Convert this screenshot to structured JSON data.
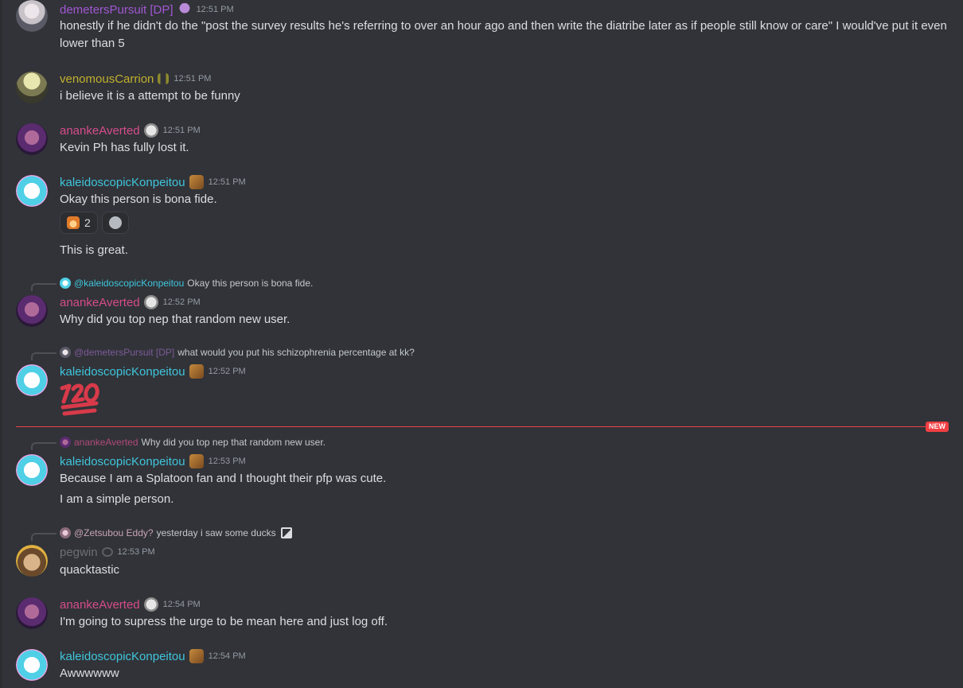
{
  "messages": [
    {
      "user": "demetersPursuit [DP]",
      "color": "#a257d3",
      "time": "12:51 PM",
      "badge": "octopus-badge",
      "text": "honestly if he didn't do the \"post the survey results he's referring to over an hour ago and then write the diatribe later as if people still know or care\" I would've put it even lower than 5"
    },
    {
      "user": "venomousCarrion",
      "color": "#c2b02e",
      "time": "12:51 PM",
      "badge": "gemini-badge",
      "text": "i believe it is a attempt to be funny"
    },
    {
      "user": "ananke Averted",
      "user_display": "anankeAverted",
      "color": "#d64c8a",
      "time": "12:51 PM",
      "badge": "wolf-badge",
      "text": "Kevin Ph has fully lost it."
    },
    {
      "user": "kaleidoscopicKonpeitou",
      "color": "#3fc5dc",
      "time": "12:51 PM",
      "badge": "dog-badge",
      "text": "Okay this person is bona fide.",
      "reaction_count": "2",
      "followup": "This is great."
    },
    {
      "user": "anankeAverted",
      "color": "#d64c8a",
      "time": "12:52 PM",
      "badge": "wolf-badge",
      "reply_user": "@kaleidoscopicKonpeitou",
      "reply_text": "Okay this person is bona fide.",
      "text": "Why did you top nep that random new user."
    },
    {
      "user": "kaleidoscopicKonpeitou",
      "color": "#3fc5dc",
      "time": "12:52 PM",
      "badge": "dog-badge",
      "reply_user": "@demetersPursuit [DP]",
      "reply_text": "what would you put his schizophrenia percentage at kk?",
      "emoji": "hundred-points-emoji"
    },
    {
      "user": "kaleidoscopicKonpeitou",
      "color": "#3fc5dc",
      "time": "12:53 PM",
      "badge": "dog-badge",
      "reply_user": "anankeAverted",
      "reply_text": "Why did you top nep that random new user.",
      "text": "Because I am a Splatoon fan and I thought their pfp was cute.",
      "followup": "I am a simple person."
    },
    {
      "user": "pegwin",
      "color": "#6d6f78",
      "time": "12:53 PM",
      "badge": "cancer-badge",
      "reply_user": "@Zetsubou Eddy?",
      "reply_text": "yesterday i saw some ducks",
      "text": "quacktastic"
    },
    {
      "user": "anankeAverted",
      "color": "#d64c8a",
      "time": "12:54 PM",
      "badge": "wolf-badge",
      "text": "I'm going to supress the urge to be mean here and just log off."
    },
    {
      "user": "kaleidoscopicKonpeitou",
      "color": "#3fc5dc",
      "time": "12:54 PM",
      "badge": "dog-badge",
      "text": "Awwwwww"
    }
  ],
  "new_label": "NEW"
}
